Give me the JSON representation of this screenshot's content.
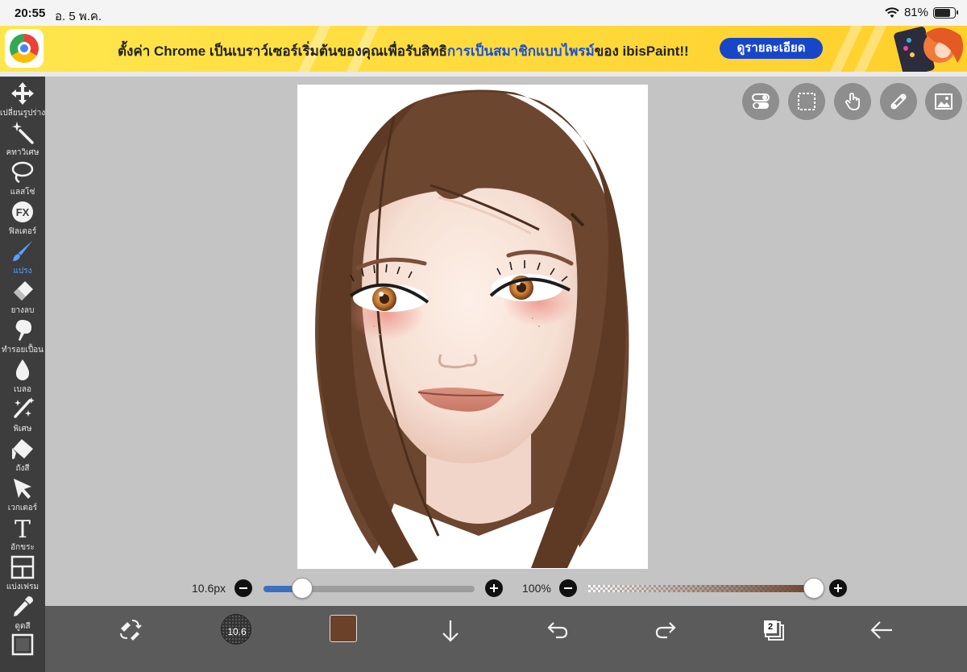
{
  "status_bar": {
    "time": "20:55",
    "date": "อ. 5 พ.ค.",
    "battery_percent": "81%",
    "battery_level": 0.81
  },
  "ad_banner": {
    "text_part1": "ตั้งค่า Chrome เป็นเบราว์เซอร์เริ่มต้นของคุณเพื่อรับสิทธิ",
    "text_highlight": "การเป็นสมาชิกแบบไพรม์",
    "text_part2": "ของ ibisPaint!!",
    "button_label": "ดูรายละเอียด",
    "highlight_color": "#1a4fd0"
  },
  "toolbar": {
    "items": [
      {
        "label": "เปลี่ยนรูปร่าง",
        "icon": "move-icon"
      },
      {
        "label": "คทาวิเศษ",
        "icon": "magic-wand-icon"
      },
      {
        "label": "แลสโซ่",
        "icon": "lasso-icon"
      },
      {
        "label": "ฟิลเตอร์",
        "icon": "fx-icon",
        "glyph": "FX"
      },
      {
        "label": "แปรง",
        "icon": "brush-icon",
        "active": true
      },
      {
        "label": "ยางลบ",
        "icon": "eraser-icon"
      },
      {
        "label": "ทำรอยเปื้อน",
        "icon": "smudge-icon"
      },
      {
        "label": "เบลอ",
        "icon": "blur-drop-icon"
      },
      {
        "label": "พิเศษ",
        "icon": "special-wand-icon"
      },
      {
        "label": "ถังสี",
        "icon": "bucket-icon"
      },
      {
        "label": "เวกเตอร์",
        "icon": "vector-arrow-icon"
      },
      {
        "label": "อักขระ",
        "icon": "text-icon",
        "glyph": "T"
      },
      {
        "label": "แบ่งเฟรม",
        "icon": "frame-divider-icon"
      },
      {
        "label": "ดูดสี",
        "icon": "eyedropper-icon"
      },
      {
        "label": "",
        "icon": "canvas-icon"
      }
    ],
    "active_color": "#5aa0ff"
  },
  "top_buttons": [
    "toggle-icon",
    "selection-icon",
    "hand-gesture-icon",
    "ruler-icon",
    "image-icon"
  ],
  "brush_size": {
    "label": "10.6px",
    "value": 10.6,
    "min": 0,
    "max": 400
  },
  "opacity": {
    "label": "100%",
    "value": 100
  },
  "bottom_bar": {
    "brush_size_value": "10.6",
    "current_color": "#6b4129",
    "layer_count": "2"
  }
}
